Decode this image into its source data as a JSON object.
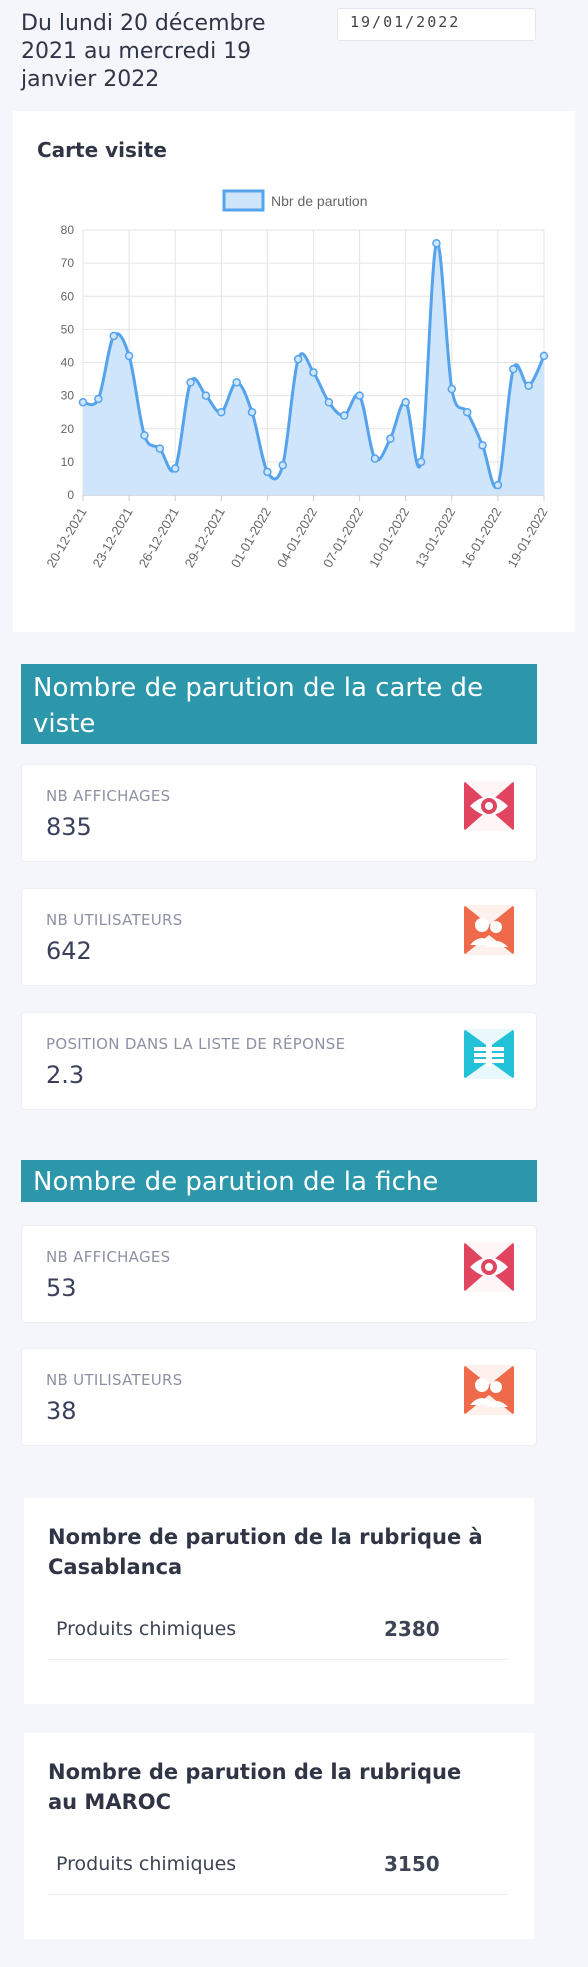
{
  "header": {
    "date_range": "Du lundi 20 décembre 2021 au mercredi 19 janvier 2022",
    "date_input_value": "19/01/2022"
  },
  "chart_card": {
    "title": "Carte visite"
  },
  "chart_data": {
    "type": "area",
    "title": "Carte visite",
    "legend": [
      "Nbr de parution"
    ],
    "legend_position": "top",
    "ylim": [
      0,
      80
    ],
    "yticks": [
      0,
      10,
      20,
      30,
      40,
      50,
      60,
      70,
      80
    ],
    "xtick_labels": [
      "20-12-2021",
      "23-12-2021",
      "26-12-2021",
      "29-12-2021",
      "01-01-2022",
      "04-01-2022",
      "07-01-2022",
      "10-01-2022",
      "13-01-2022",
      "16-01-2022",
      "19-01-2022"
    ],
    "grid": true,
    "line_color": "#55a3ec",
    "fill_color": "#cfe5fb",
    "series": [
      {
        "name": "Nbr de parution",
        "x": [
          "20-12-2021",
          "21-12-2021",
          "22-12-2021",
          "23-12-2021",
          "24-12-2021",
          "25-12-2021",
          "26-12-2021",
          "27-12-2021",
          "28-12-2021",
          "29-12-2021",
          "30-12-2021",
          "31-12-2021",
          "01-01-2022",
          "02-01-2022",
          "03-01-2022",
          "04-01-2022",
          "05-01-2022",
          "06-01-2022",
          "07-01-2022",
          "08-01-2022",
          "09-01-2022",
          "10-01-2022",
          "11-01-2022",
          "12-01-2022",
          "13-01-2022",
          "14-01-2022",
          "15-01-2022",
          "16-01-2022",
          "17-01-2022",
          "18-01-2022",
          "19-01-2022"
        ],
        "values": [
          28,
          29,
          48,
          42,
          18,
          14,
          8,
          34,
          30,
          25,
          34,
          25,
          7,
          9,
          41,
          37,
          28,
          24,
          30,
          11,
          17,
          28,
          10,
          76,
          32,
          25,
          15,
          3,
          38,
          33,
          42
        ]
      }
    ]
  },
  "section1": {
    "title": "Nombre de parution de la carte de viste",
    "cards": [
      {
        "label": "NB AFFICHAGES",
        "value": "835",
        "icon": "eye-icon",
        "color": "#e0445f"
      },
      {
        "label": "NB UTILISATEURS",
        "value": "642",
        "icon": "users-icon",
        "color": "#ef6a4a"
      },
      {
        "label": "POSITION DANS LA LISTE DE RÉPONSE",
        "value": "2.3",
        "icon": "list-position-icon",
        "color": "#23c1d8"
      }
    ]
  },
  "section2": {
    "title": "Nombre de parution de la fiche",
    "cards": [
      {
        "label": "NB AFFICHAGES",
        "value": "53",
        "icon": "eye-icon",
        "color": "#e0445f"
      },
      {
        "label": "NB UTILISATEURS",
        "value": "38",
        "icon": "users-icon",
        "color": "#ef6a4a"
      }
    ]
  },
  "rubric_casablanca": {
    "title": "Nombre de parution de la rubrique à Casablanca",
    "rows": [
      {
        "label": "Produits chimiques",
        "value": "2380"
      }
    ]
  },
  "rubric_maroc": {
    "title": "Nombre de parution de la rubrique au MAROC",
    "rows": [
      {
        "label": "Produits chimiques",
        "value": "3150"
      }
    ]
  }
}
